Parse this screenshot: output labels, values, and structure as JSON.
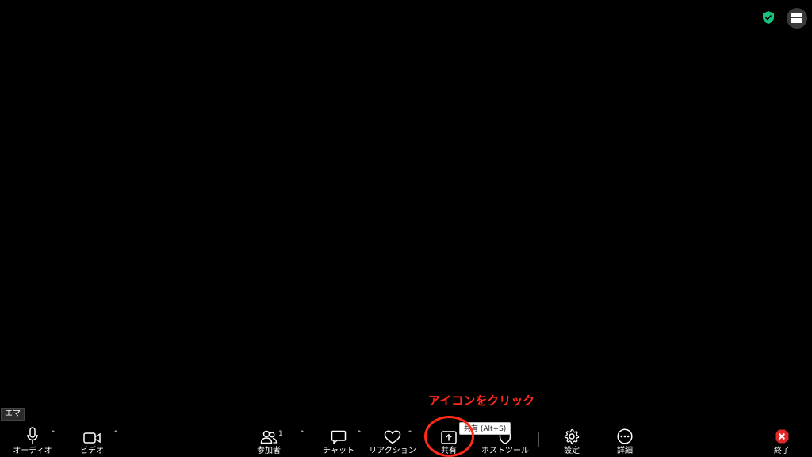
{
  "meeting": {
    "name_tag": "エマ"
  },
  "toolbar": {
    "audio_label": "オーディオ",
    "video_label": "ビデオ",
    "participants_label": "参加者",
    "participants_count": "1",
    "chat_label": "チャット",
    "reactions_label": "リアクション",
    "share_label": "共有",
    "host_tools_label": "ホストツール",
    "settings_label": "設定",
    "more_label": "詳細",
    "end_label": "終了",
    "caret_glyph": "^"
  },
  "tooltip": {
    "text": "共有 (Alt+S)"
  },
  "annotation": {
    "text": "アイコンをクリック",
    "color": "#ff2a1a"
  },
  "colors": {
    "background": "#000000",
    "shield": "#19c37d",
    "end_button": "#e02828"
  },
  "icons": {
    "shield": "security-shield-icon",
    "view": "gallery-view-icon",
    "audio": "microphone-icon",
    "video": "video-camera-icon",
    "participants": "participants-icon",
    "chat": "chat-bubble-icon",
    "reactions": "heart-icon",
    "share": "share-screen-icon",
    "host_tools": "shield-icon",
    "settings": "gear-icon",
    "more": "ellipsis-icon",
    "end": "close-icon"
  }
}
